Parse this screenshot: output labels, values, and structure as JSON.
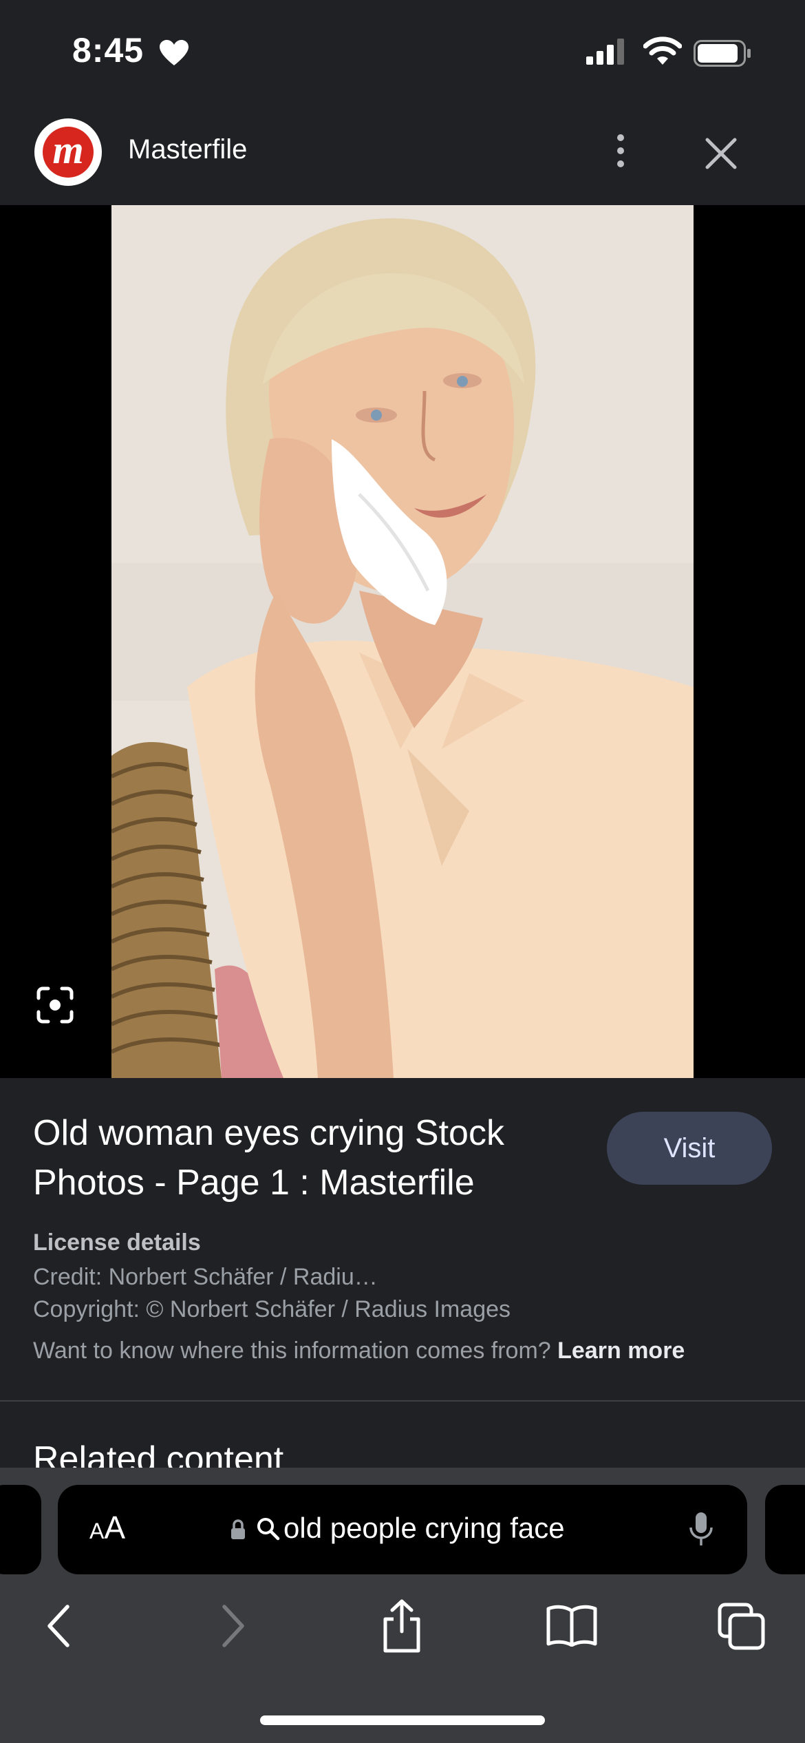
{
  "status_bar": {
    "time": "8:45"
  },
  "header": {
    "site_name": "Masterfile",
    "logo_letter": "m"
  },
  "result": {
    "title": "Old woman eyes crying Stock Photos - Page 1 : Masterfile",
    "visit_label": "Visit",
    "license_heading": "License details",
    "credit": "Credit: Norbert Schäfer / Radiu…",
    "copyright": "Copyright: © Norbert Schäfer / Radius Images",
    "info_question": "Want to know where this information comes from?",
    "learn_more": "Learn more",
    "related_heading": "Related content"
  },
  "browser": {
    "text_size_label_small": "A",
    "text_size_label_large": "A",
    "search_query": "old people crying face"
  },
  "colors": {
    "background": "#202124",
    "visit_button": "#3c4357",
    "toolbar": "#3a3b3e",
    "logo_red": "#d7261e"
  }
}
